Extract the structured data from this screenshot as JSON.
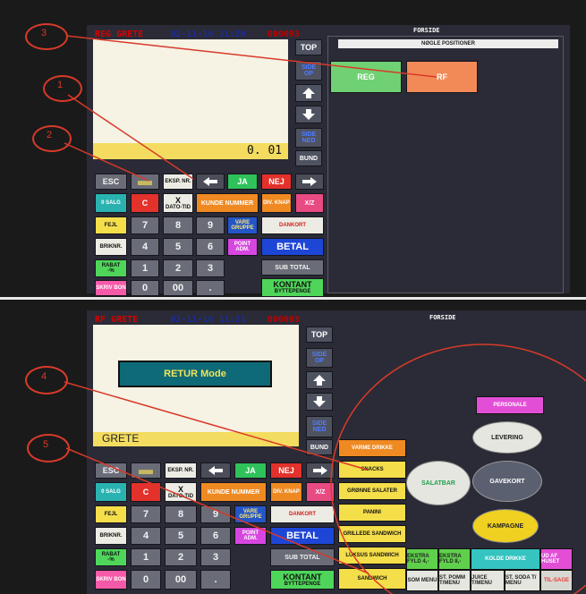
{
  "photo1": {
    "header": {
      "mode": "REG",
      "user": "GRETE",
      "datetime": "02-11-16 11:20",
      "number": "000093"
    },
    "amount": "0. 01",
    "panel_title": "FORSIDE",
    "panel_subtitle": "NØGLE POSITIONER",
    "panel_buttons": [
      {
        "label": "REG",
        "color": "#6fd173"
      },
      {
        "label": "RF",
        "color": "#f28a58"
      }
    ]
  },
  "photo2": {
    "header": {
      "mode": "RF",
      "user": "GRETE",
      "datetime": "02-11-16 11:21",
      "number": "000093"
    },
    "retur_mode": "RETUR Mode",
    "display_name": "GRETE",
    "panel_title": "FORSIDE",
    "category_buttons": [
      "VARME DRIKKE",
      "SNACKS",
      "GRØNNE SALATER",
      "PANINI",
      "GRILLEDE SANDWICH",
      "LUKSUS SANDWICH",
      "SANDWICH"
    ],
    "oval_buttons": [
      "PERSONALE",
      "LEVERING",
      "SALATBAR",
      "GAVEKORT",
      "KAMPAGNE"
    ],
    "bottom_row1": [
      "EKSTRA FYLD 4,-",
      "EKSTRA FYLD 8,-",
      "KOLDE DRIKKE",
      "UD AF HUSET"
    ],
    "bottom_row2": [
      "SOM MENU",
      "ST. POMM T/MENU",
      "JUICE T/MENU",
      "ST. SODA T/ MENU",
      "TIL-SAGE"
    ]
  },
  "keypad": {
    "nav": [
      "TOP",
      "SIDE OP",
      "SIDE NED",
      "BUND"
    ],
    "esc": "ESC",
    "eksp": "EKSP. NR.",
    "ja": "JA",
    "nej": "NEJ",
    "o_salg": "0 SALG",
    "c": "C",
    "x_dato": "X",
    "dato_tid": "DATO-TID",
    "kunde_nummer": "KUNDE NUMMER",
    "div_knap": "DIV. KNAP",
    "xz": "X/Z",
    "fejl": "FEJL",
    "vare_gruppe": "VARE GRUPPE",
    "dankort": "DANKORT",
    "briknr": "BRIKNR.",
    "point_adm": "POINT ADM.",
    "betal": "BETAL",
    "rabat": "RABAT",
    "rabat_pct": "-%",
    "sub_total": "SUB TOTAL",
    "skriv_bon": "SKRIV BON",
    "kontant": "KONTANT",
    "byttepenge": "BYTTEPENGE",
    "digits": [
      "7",
      "8",
      "9",
      "4",
      "5",
      "6",
      "1",
      "2",
      "3",
      "0",
      "00",
      "."
    ]
  },
  "annotations": [
    "1",
    "2",
    "3",
    "4",
    "5"
  ],
  "colors": {
    "annotation": "#d83a2a",
    "panel_bg": "#2a2b36",
    "display_bg": "#f6f2e4"
  }
}
